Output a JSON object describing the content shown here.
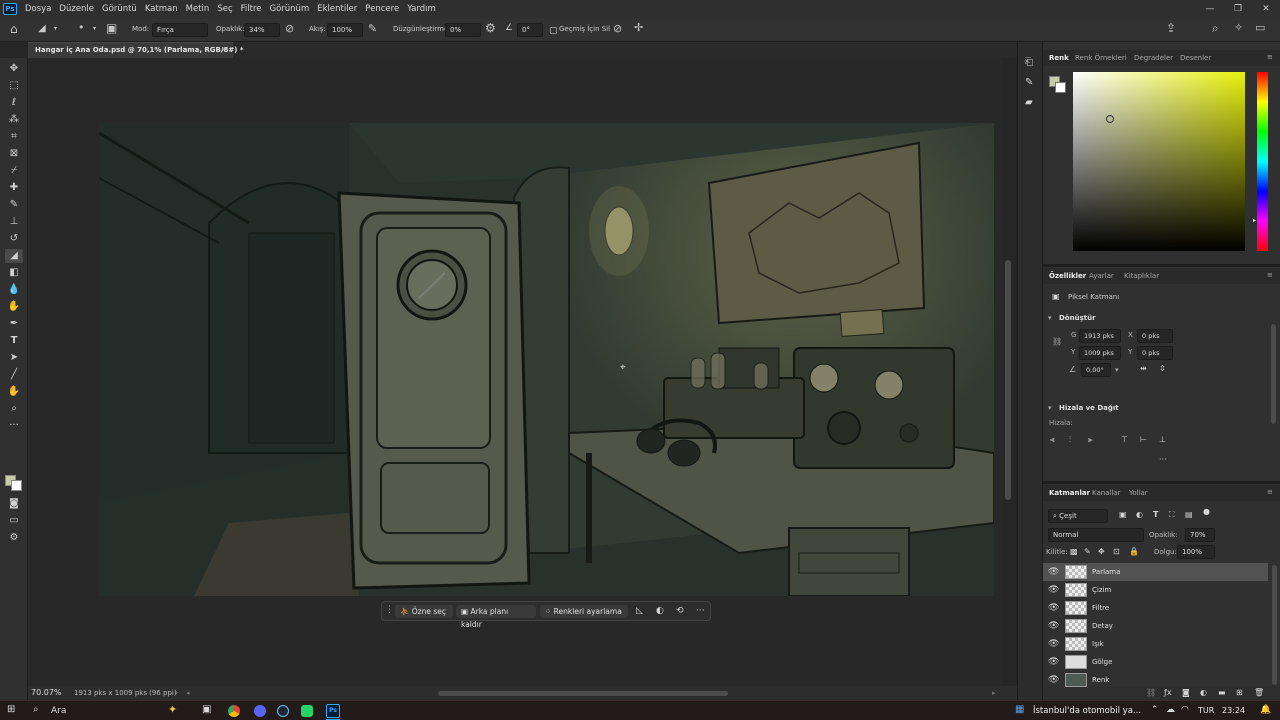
{
  "app": {
    "logo": "Ps",
    "menu": [
      "Dosya",
      "Düzenle",
      "Görüntü",
      "Katman",
      "Metin",
      "Seç",
      "Filtre",
      "Görünüm",
      "Eklentiler",
      "Pencere",
      "Yardım"
    ]
  },
  "options": {
    "mode_label": "Mod:",
    "mode_value": "Fırça",
    "opacity_label": "Opaklık:",
    "opacity_value": "34%",
    "flow_label": "Akış:",
    "flow_value": "100%",
    "smoothing_label": "Düzgünleştirme:",
    "smoothing_value": "0%",
    "angle_value": "0°",
    "history_erase_label": "Geçmiş İçin Sil"
  },
  "document": {
    "tab_title": "Hangar iç Ana Oda.psd @ 70,1% (Parlama, RGB/8#) *",
    "zoom": "70.07%",
    "info": "1913 pks x 1009 pks (96 ppi)"
  },
  "contextual": {
    "select_subject": "Özne seç",
    "remove_bg": "Arka planı kaldır",
    "adjust_colors": "Renkleri ayarlama"
  },
  "color_panel": {
    "tabs": [
      "Renk",
      "Renk Örnekleri",
      "Degradeler",
      "Desenler"
    ],
    "base_hue": "#e7f00c",
    "foreground": "#c8cba7",
    "background": "#ffffff"
  },
  "properties": {
    "tabs": [
      "Özellikler",
      "Ayarlar",
      "Kitaplıklar"
    ],
    "layer_type": "Piksel Katmanı",
    "transform_title": "Dönüştür",
    "w_label": "G",
    "w_value": "1913 pks",
    "h_label": "Y",
    "h_value": "1009 pks",
    "x_label": "X",
    "x_value": "0 pks",
    "y_label": "Y",
    "y_value": "0 pks",
    "angle": "0,00°",
    "align_title": "Hizala ve Dağıt",
    "align_label": "Hizala:"
  },
  "layers_panel": {
    "tabs": [
      "Katmanlar",
      "Kanallar",
      "Yollar"
    ],
    "filter_kind": "Çeşit",
    "blend_mode": "Normal",
    "opacity_label": "Opaklık:",
    "opacity_value": "70%",
    "lock_label": "Kilitle:",
    "fill_label": "Dolgu:",
    "fill_value": "100%",
    "layers": [
      {
        "name": "Parlama",
        "selected": true
      },
      {
        "name": "Çizim",
        "selected": false
      },
      {
        "name": "Filtre",
        "selected": false
      },
      {
        "name": "Detay",
        "selected": false
      },
      {
        "name": "Işık",
        "selected": false
      },
      {
        "name": "Gölge",
        "selected": false
      },
      {
        "name": "Renk",
        "selected": false
      }
    ]
  },
  "taskbar": {
    "search": "Ara",
    "news": "İstanbul'da otomobil ya...",
    "lang": "TUR",
    "time": "23:24"
  }
}
